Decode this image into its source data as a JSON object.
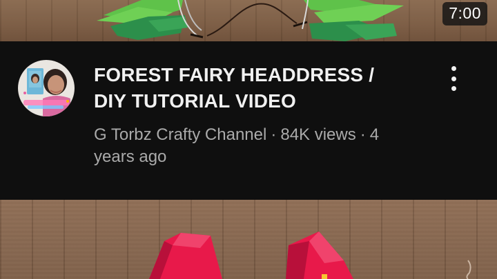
{
  "current_video": {
    "duration": "7:00",
    "title_line1": "FOREST FAIRY HEADDRESS /",
    "title_line2": "DIY TUTORIAL VIDEO",
    "channel": "G Torbz Crafty Channel",
    "separator": "·",
    "views": "84K views",
    "age_line1": "4",
    "age_line2": "years ago"
  },
  "colors": {
    "background": "#0f0f0f",
    "title_text": "#f1f1f1",
    "meta_text": "#aaaaaa",
    "duration_badge": "#141414",
    "leaf_light": "#5fc24a",
    "leaf_dark": "#2c8f4b",
    "paper_red": "#e8194a"
  },
  "icons": {
    "menu": "more-vert-icon"
  }
}
